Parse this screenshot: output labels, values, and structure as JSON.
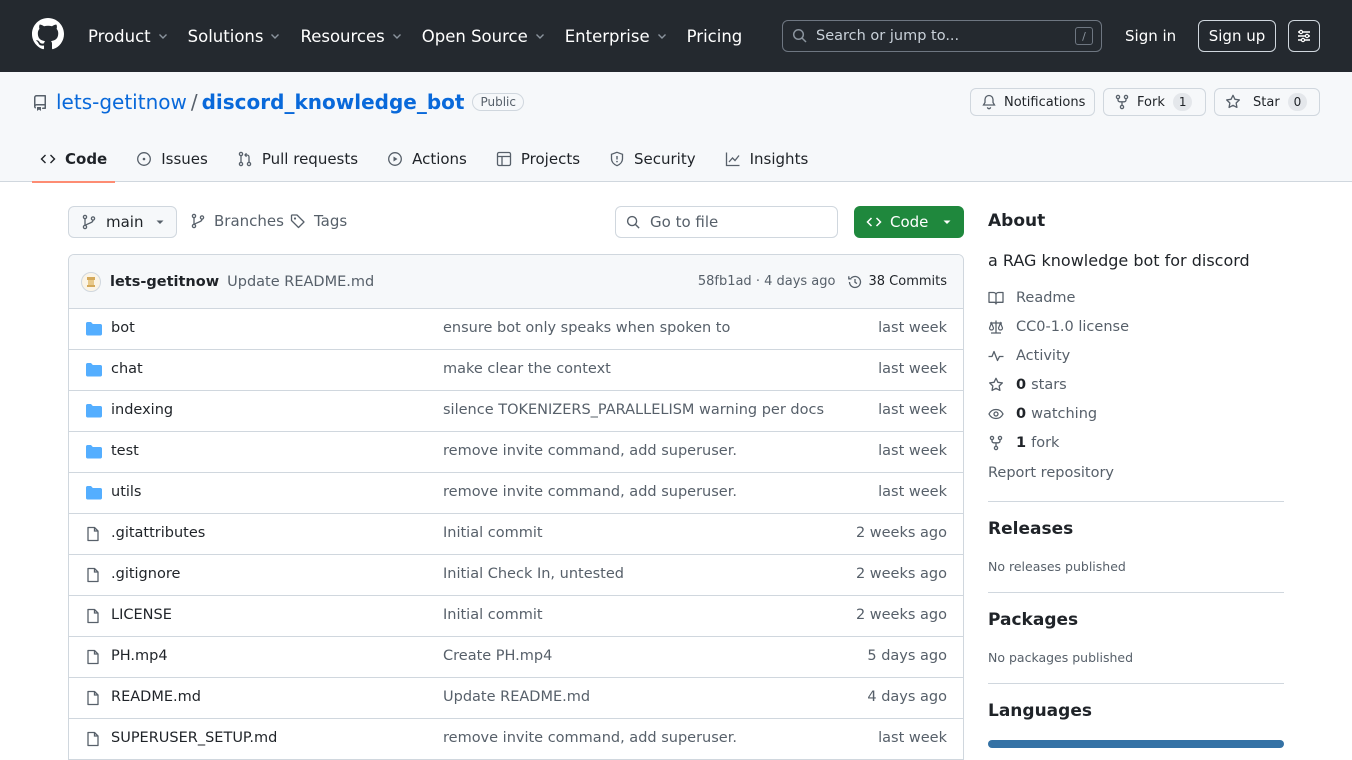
{
  "header": {
    "nav": [
      {
        "label": "Product",
        "dropdown": true
      },
      {
        "label": "Solutions",
        "dropdown": true
      },
      {
        "label": "Resources",
        "dropdown": true
      },
      {
        "label": "Open Source",
        "dropdown": true
      },
      {
        "label": "Enterprise",
        "dropdown": true
      },
      {
        "label": "Pricing",
        "dropdown": false
      }
    ],
    "search_placeholder": "Search or jump to...",
    "search_shortcut": "/",
    "signin": "Sign in",
    "signup": "Sign up"
  },
  "repo": {
    "owner": "lets-getitnow",
    "separator": "/",
    "name": "discord_knowledge_bot",
    "visibility": "Public",
    "notifications_label": "Notifications",
    "fork_label": "Fork",
    "fork_count": "1",
    "star_label": "Star",
    "star_count": "0"
  },
  "tabs": [
    {
      "label": "Code",
      "icon": "code-icon",
      "active": true
    },
    {
      "label": "Issues",
      "icon": "issue-icon",
      "active": false
    },
    {
      "label": "Pull requests",
      "icon": "pull-request-icon",
      "active": false
    },
    {
      "label": "Actions",
      "icon": "play-icon",
      "active": false
    },
    {
      "label": "Projects",
      "icon": "table-icon",
      "active": false
    },
    {
      "label": "Security",
      "icon": "shield-icon",
      "active": false
    },
    {
      "label": "Insights",
      "icon": "graph-icon",
      "active": false
    }
  ],
  "toolbar": {
    "branch": "main",
    "branches_label": "Branches",
    "tags_label": "Tags",
    "goto_placeholder": "Go to file",
    "code_button": "Code"
  },
  "commit": {
    "author": "lets-getitnow",
    "message": "Update README.md",
    "meta": "58fb1ad · 4 days ago",
    "commits_label": "38 Commits"
  },
  "files": [
    {
      "type": "dir",
      "name": "bot",
      "message": "ensure bot only speaks when spoken to",
      "date": "last week"
    },
    {
      "type": "dir",
      "name": "chat",
      "message": "make clear the context",
      "date": "last week"
    },
    {
      "type": "dir",
      "name": "indexing",
      "message": "silence TOKENIZERS_PARALLELISM warning per docs",
      "date": "last week"
    },
    {
      "type": "dir",
      "name": "test",
      "message": "remove invite command, add superuser.",
      "date": "last week"
    },
    {
      "type": "dir",
      "name": "utils",
      "message": "remove invite command, add superuser.",
      "date": "last week"
    },
    {
      "type": "file",
      "name": ".gitattributes",
      "message": "Initial commit",
      "date": "2 weeks ago"
    },
    {
      "type": "file",
      "name": ".gitignore",
      "message": "Initial Check In, untested",
      "date": "2 weeks ago"
    },
    {
      "type": "file",
      "name": "LICENSE",
      "message": "Initial commit",
      "date": "2 weeks ago"
    },
    {
      "type": "file",
      "name": "PH.mp4",
      "message": "Create PH.mp4",
      "date": "5 days ago"
    },
    {
      "type": "file",
      "name": "README.md",
      "message": "Update README.md",
      "date": "4 days ago"
    },
    {
      "type": "file",
      "name": "SUPERUSER_SETUP.md",
      "message": "remove invite command, add superuser.",
      "date": "last week"
    }
  ],
  "about": {
    "title": "About",
    "description": "a RAG knowledge bot for discord",
    "readme": "Readme",
    "license": "CC0-1.0 license",
    "activity": "Activity",
    "stars_count": "0",
    "stars_label": "stars",
    "watching_count": "0",
    "watching_label": "watching",
    "fork_count": "1",
    "fork_label": "fork",
    "report": "Report repository"
  },
  "releases": {
    "title": "Releases",
    "note": "No releases published"
  },
  "packages": {
    "title": "Packages",
    "note": "No packages published"
  },
  "languages": {
    "title": "Languages",
    "bar_color": "#3572a5"
  },
  "colors": {
    "header_bg": "#24292f",
    "link": "#0969da",
    "primary_button": "#1f883d",
    "active_tab_underline": "#fd8c73",
    "folder": "#54aeff"
  }
}
